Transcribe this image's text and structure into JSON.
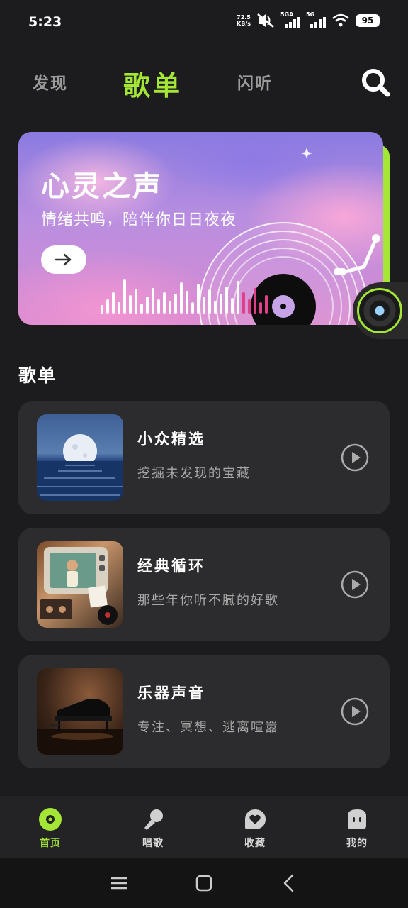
{
  "status_bar": {
    "time": "5:23",
    "net_speed_value": "72.5",
    "net_speed_unit": "KB/s",
    "signal_1": "5GA",
    "signal_2": "5G",
    "battery": "95"
  },
  "top_nav": {
    "tabs": [
      {
        "label": "发现",
        "active": false
      },
      {
        "label": "歌单",
        "active": true
      },
      {
        "label": "闪听",
        "active": false
      }
    ],
    "search_icon": "search-icon"
  },
  "banner": {
    "title": "心灵之声",
    "subtitle": "情绪共鸣，陪伴你日日夜夜",
    "button_icon": "arrow-right-icon"
  },
  "section": {
    "title": "歌单"
  },
  "playlists": [
    {
      "title": "小众精选",
      "description": "挖掘未发现的宝藏",
      "thumb": "moon-over-sea"
    },
    {
      "title": "经典循环",
      "description": "那些年你听不腻的好歌",
      "thumb": "retro-tv-collage"
    },
    {
      "title": "乐器声音",
      "description": "专注、冥想、逃离喧嚣",
      "thumb": "grand-piano"
    }
  ],
  "bottom_nav": [
    {
      "label": "首页",
      "icon": "disc-icon",
      "active": true
    },
    {
      "label": "唱歌",
      "icon": "microphone-icon",
      "active": false
    },
    {
      "label": "收藏",
      "icon": "heart-icon",
      "active": false
    },
    {
      "label": "我的",
      "icon": "profile-icon",
      "active": false
    }
  ],
  "colors": {
    "accent": "#a3e635",
    "background": "#1c1c1e",
    "card": "#2c2c2e"
  }
}
